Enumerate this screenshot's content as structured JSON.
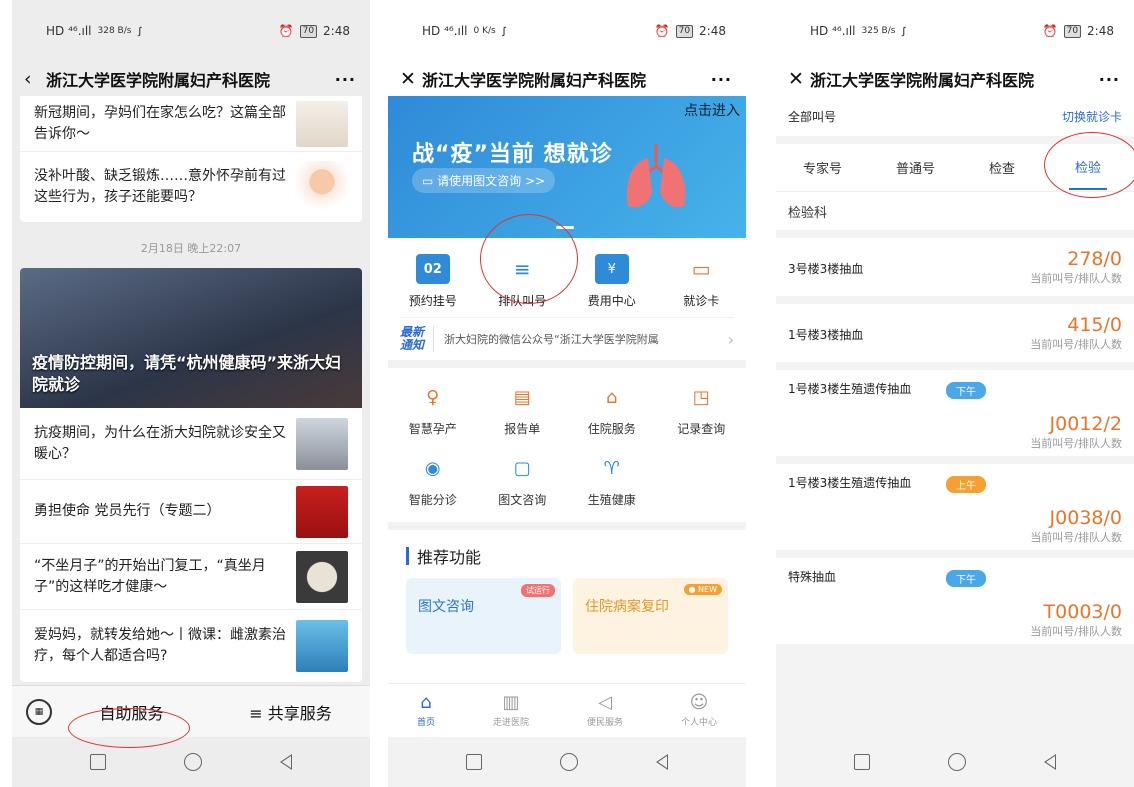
{
  "phone1": {
    "status": {
      "signal": "HD ⁴⁶.ıll",
      "speed": "328 B/s",
      "icon": "ꭍ",
      "time": "2:48",
      "battery": "70"
    },
    "title": "浙江大学医学院附属妇产科医院",
    "back_icon": "‹",
    "more_icon": "···",
    "articles_top": [
      {
        "text": "新冠期间，孕妈们在家怎么吃？这篇全部告诉你～"
      },
      {
        "text": "没补叶酸、缺乏锻炼……意外怀孕前有过这些行为，孩子还能要吗？"
      }
    ],
    "date": "2月18日 晚上22:07",
    "hero_caption": "疫情防控期间，请凭“杭州健康码”来浙大妇院就诊",
    "articles": [
      {
        "text": "抗疫期间，为什么在浙大妇院就诊安全又暖心？"
      },
      {
        "text": "勇担使命 党员先行（专题二）"
      },
      {
        "text": "“不坐月子”的开始出门复工，“真坐月子”的这样吃才健康～"
      },
      {
        "text": "爱妈妈，就转发给她～丨微课：雌激素治疗，每个人都适合吗?"
      }
    ],
    "bottom": {
      "self_service": "自助服务",
      "share_service": "≡ 共享服务",
      "keyboard": "▦"
    }
  },
  "phone2": {
    "status": {
      "signal": "HD ⁴⁶.ıll",
      "speed": "0 K/s",
      "icon": "ꭍ",
      "time": "2:48",
      "battery": "70"
    },
    "title": "浙江大学医学院附属妇产科医院",
    "close_icon": "✕",
    "more_icon": "···",
    "banner": {
      "click": "点击进入",
      "slogan": "战“疫”当前 想就诊",
      "consult": "▭ 请使用图文咨询 >>"
    },
    "quick": [
      {
        "label": "预约挂号",
        "icon": "02"
      },
      {
        "label": "排队叫号",
        "icon": "≡"
      },
      {
        "label": "费用中心",
        "icon": "¥"
      },
      {
        "label": "就诊卡",
        "icon": "▭"
      }
    ],
    "notice": {
      "tag": "最新通知",
      "text": "浙大妇院的微信公众号“浙江大学医学院附属",
      "arrow": "›"
    },
    "services": [
      {
        "label": "智慧孕产",
        "icon": "♀"
      },
      {
        "label": "报告单",
        "icon": "▤"
      },
      {
        "label": "住院服务",
        "icon": "⌂"
      },
      {
        "label": "记录查询",
        "icon": "◳"
      },
      {
        "label": "智能分诊",
        "icon": "◉"
      },
      {
        "label": "图文咨询",
        "icon": "▢"
      },
      {
        "label": "生殖健康",
        "icon": "♈"
      }
    ],
    "recommend": {
      "title": "推荐功能",
      "card1": {
        "label": "图文咨询",
        "badge": "试运行"
      },
      "card2": {
        "label": "住院病案复印",
        "badge": "● NEW"
      }
    },
    "tabs": [
      {
        "label": "首页",
        "icon": "⌂"
      },
      {
        "label": "走进医院",
        "icon": "▥"
      },
      {
        "label": "便民服务",
        "icon": "◁"
      },
      {
        "label": "个人中心",
        "icon": "☺"
      }
    ]
  },
  "phone3": {
    "status": {
      "signal": "HD ⁴⁶.ıll",
      "speed": "325 B/s",
      "icon": "ꭍ",
      "time": "2:48",
      "battery": "70"
    },
    "title": "浙江大学医学院附属妇产科医院",
    "close_icon": "✕",
    "more_icon": "···",
    "all_queues": "全部叫号",
    "switch_card": "切换就诊卡",
    "tabs": [
      "专家号",
      "普通号",
      "检查",
      "检验"
    ],
    "department": "检验科",
    "queues": [
      {
        "name": "3号楼3楼抽血",
        "value": "278/0",
        "caption": "当前叫号/排队人数",
        "pill": ""
      },
      {
        "name": "1号楼3楼抽血",
        "value": "415/0",
        "caption": "当前叫号/排队人数",
        "pill": ""
      },
      {
        "name": "1号楼3楼生殖遗传抽血",
        "value": "J0012/2",
        "caption": "当前叫号/排队人数",
        "pill": "下午"
      },
      {
        "name": "1号楼3楼生殖遗传抽血",
        "value": "J0038/0",
        "caption": "当前叫号/排队人数",
        "pill": "上午"
      },
      {
        "name": "特殊抽血",
        "value": "T0003/0",
        "caption": "当前叫号/排队人数",
        "pill": "下午"
      }
    ]
  },
  "colors": {
    "accent": "#2a6ad8",
    "orange": "#e8752a",
    "annotation": "#e0332f"
  }
}
